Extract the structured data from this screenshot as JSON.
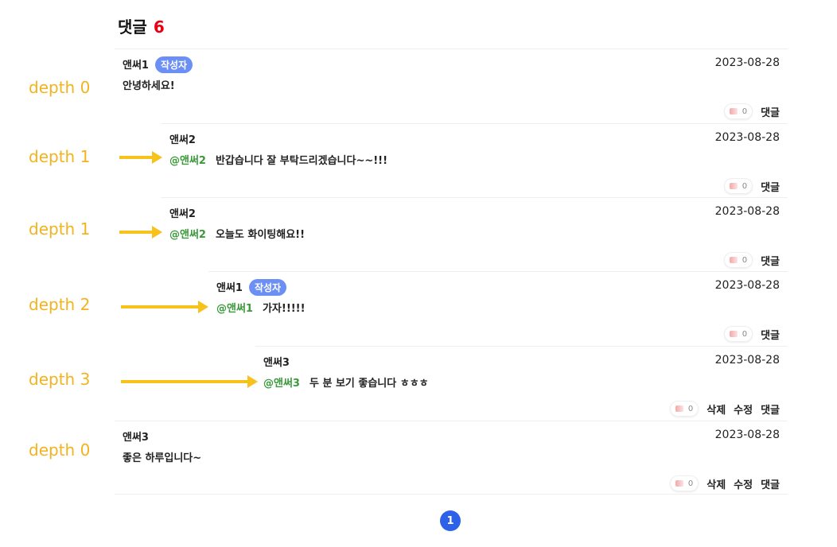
{
  "header": {
    "title": "댓글",
    "count": "6"
  },
  "comments": [
    {
      "author": "앤써1",
      "badge": "작성자",
      "date": "2023-08-28",
      "mention": "",
      "text": "안녕하세요!",
      "likes": "0",
      "delete_label": "",
      "edit_label": "",
      "reply_label": "댓글"
    },
    {
      "author": "앤써2",
      "badge": "",
      "date": "2023-08-28",
      "mention": "@앤써2",
      "text": "반갑습니다 잘 부탁드리겠습니다~~!!!",
      "likes": "0",
      "delete_label": "",
      "edit_label": "",
      "reply_label": "댓글"
    },
    {
      "author": "앤써2",
      "badge": "",
      "date": "2023-08-28",
      "mention": "@앤써2",
      "text": "오늘도 화이팅해요!!",
      "likes": "0",
      "delete_label": "",
      "edit_label": "",
      "reply_label": "댓글"
    },
    {
      "author": "앤써1",
      "badge": "작성자",
      "date": "2023-08-28",
      "mention": "@앤써1",
      "text": "가자!!!!!",
      "likes": "0",
      "delete_label": "",
      "edit_label": "",
      "reply_label": "댓글"
    },
    {
      "author": "앤써3",
      "badge": "",
      "date": "2023-08-28",
      "mention": "@앤써3",
      "text": "두 분 보기 좋습니다 ㅎㅎㅎ",
      "likes": "0",
      "delete_label": "삭제",
      "edit_label": "수정",
      "reply_label": "댓글"
    },
    {
      "author": "앤써3",
      "badge": "",
      "date": "2023-08-28",
      "mention": "",
      "text": "좋은 하루입니다~",
      "likes": "0",
      "delete_label": "삭제",
      "edit_label": "수정",
      "reply_label": "댓글"
    }
  ],
  "depth_labels": [
    "depth 0",
    "depth 1",
    "depth 1",
    "depth 2",
    "depth 3",
    "depth 0"
  ],
  "pagination": {
    "current": "1"
  },
  "colors": {
    "accent_count": "#e60012",
    "badge": "#6b8ff5",
    "mention": "#3a9a3a",
    "annotation": "#f3b31e",
    "page_active": "#2c61e8"
  }
}
